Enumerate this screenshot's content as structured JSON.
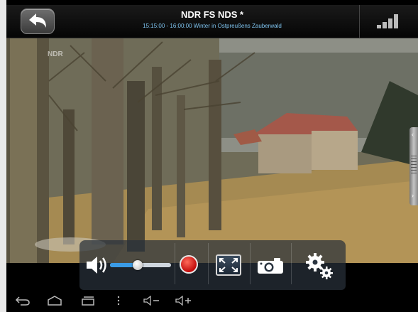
{
  "header": {
    "channel_title": "NDR FS NDS *",
    "program_info": "15:15:00 - 16:00:00 Winter in Ostpreußens Zauberwald"
  },
  "video": {
    "watermark": "NDR"
  },
  "controls": {
    "volume_level": 0.45,
    "accent_color": "#3a9be6",
    "record_color": "#d01010",
    "icons": [
      "volume-icon",
      "record-icon",
      "fullscreen-icon",
      "camera-icon",
      "settings-icon"
    ]
  },
  "nav": {
    "icons": [
      "back-nav-icon",
      "home-nav-icon",
      "recents-nav-icon",
      "menu-nav-icon",
      "volume-down-icon",
      "volume-up-icon"
    ]
  }
}
